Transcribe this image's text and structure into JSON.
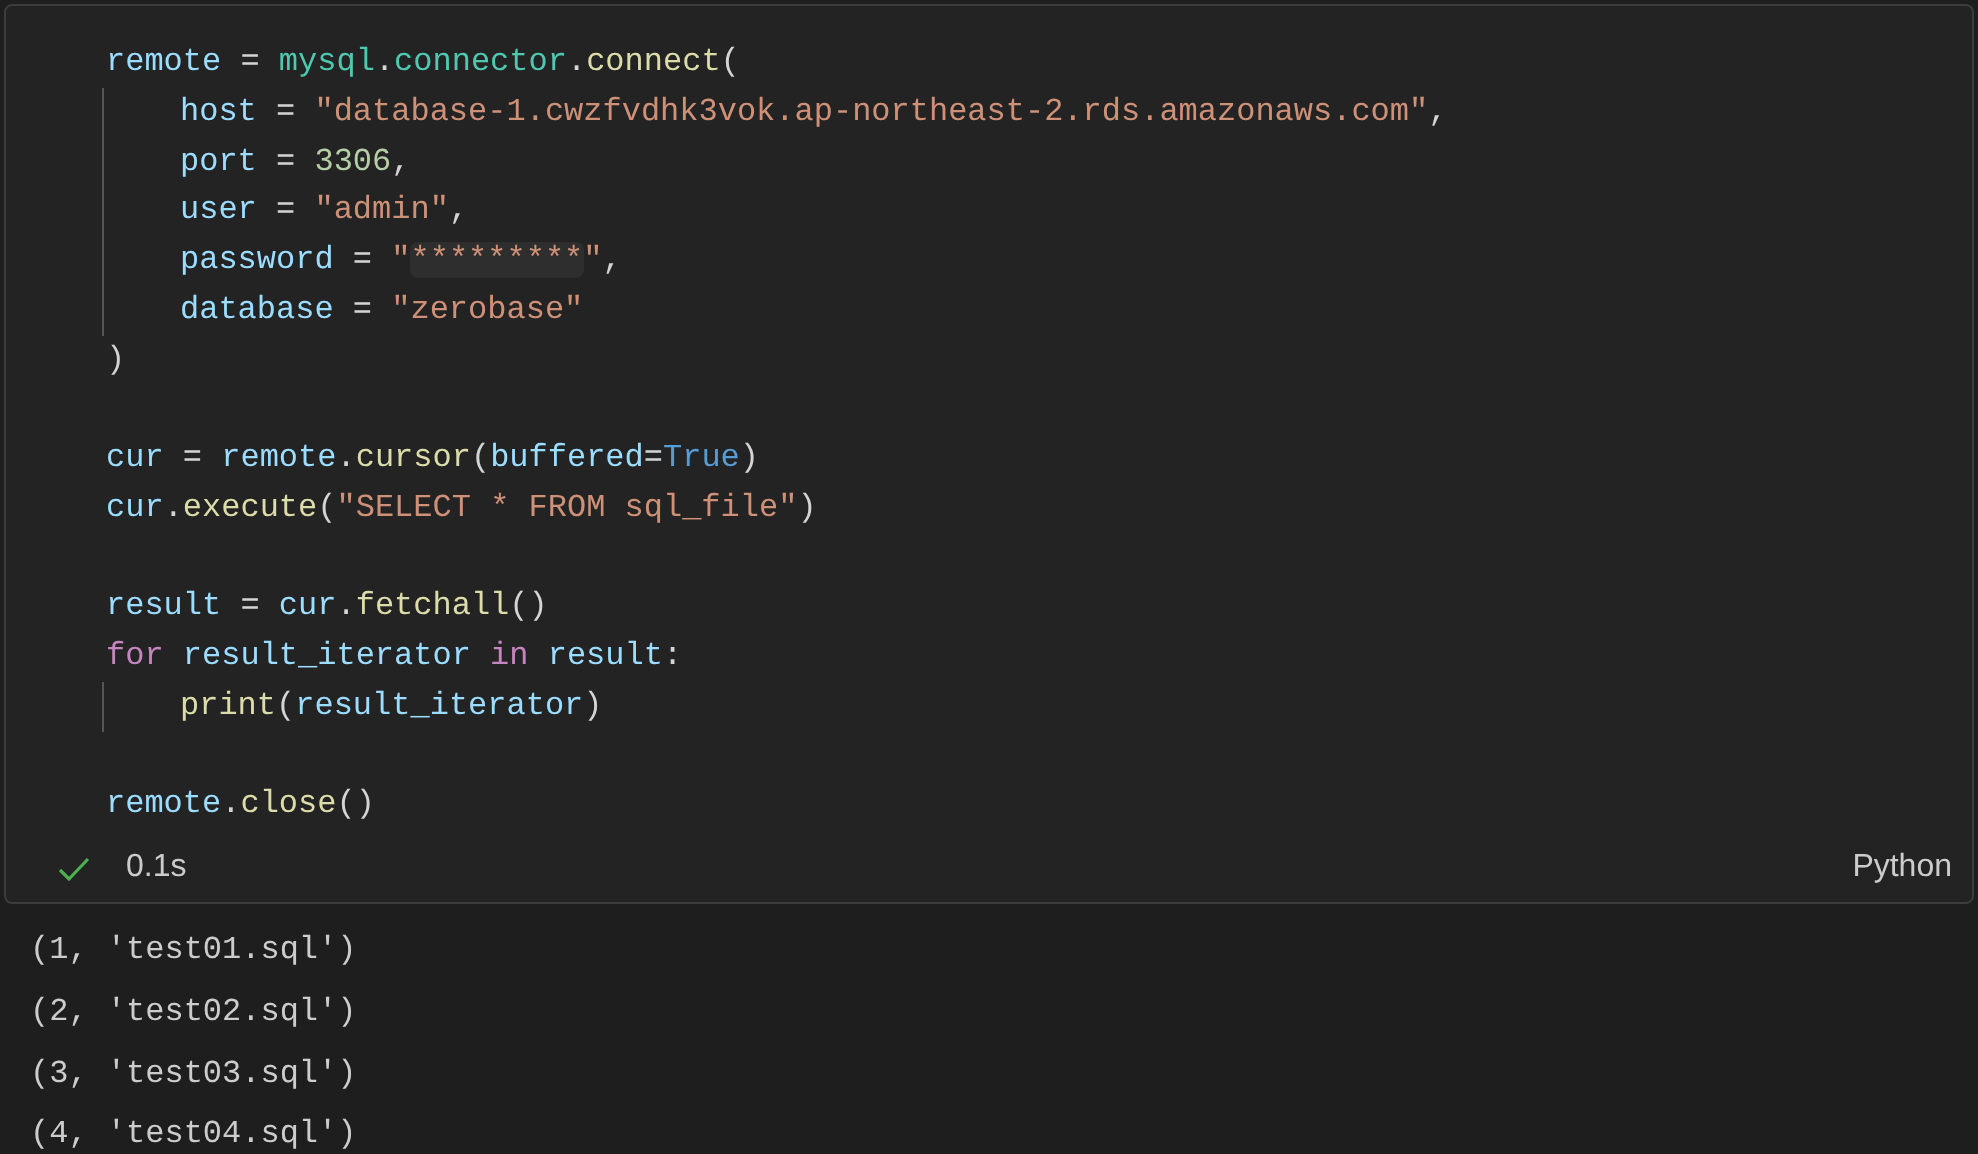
{
  "cell": {
    "lines": [
      {
        "kind": "code",
        "indented": false,
        "tokens": [
          {
            "kind": "var",
            "text": "remote"
          },
          {
            "kind": "punct",
            "text": " = "
          },
          {
            "kind": "module",
            "text": "mysql"
          },
          {
            "kind": "punct",
            "text": "."
          },
          {
            "kind": "module",
            "text": "connector"
          },
          {
            "kind": "punct",
            "text": "."
          },
          {
            "kind": "func",
            "text": "connect"
          },
          {
            "kind": "punct",
            "text": "("
          }
        ]
      },
      {
        "kind": "code",
        "indented": true,
        "tokens": [
          {
            "kind": "var",
            "text": "host"
          },
          {
            "kind": "punct",
            "text": " = "
          },
          {
            "kind": "str",
            "text": "\"database-1.cwzfvdhk3vok.ap-northeast-2.rds.amazonaws.com\""
          },
          {
            "kind": "punct",
            "text": ","
          }
        ]
      },
      {
        "kind": "code",
        "indented": true,
        "tokens": [
          {
            "kind": "var",
            "text": "port"
          },
          {
            "kind": "punct",
            "text": " = "
          },
          {
            "kind": "num",
            "text": "3306"
          },
          {
            "kind": "punct",
            "text": ","
          }
        ]
      },
      {
        "kind": "code",
        "indented": true,
        "tokens": [
          {
            "kind": "var",
            "text": "user"
          },
          {
            "kind": "punct",
            "text": " = "
          },
          {
            "kind": "str",
            "text": "\"admin\""
          },
          {
            "kind": "punct",
            "text": ","
          }
        ]
      },
      {
        "kind": "code",
        "indented": true,
        "tokens": [
          {
            "kind": "var",
            "text": "password"
          },
          {
            "kind": "punct",
            "text": " = "
          },
          {
            "kind": "str",
            "text": "\""
          },
          {
            "kind": "masked",
            "text": "*********"
          },
          {
            "kind": "str",
            "text": "\""
          },
          {
            "kind": "punct",
            "text": ","
          }
        ]
      },
      {
        "kind": "code",
        "indented": true,
        "tokens": [
          {
            "kind": "var",
            "text": "database"
          },
          {
            "kind": "punct",
            "text": " = "
          },
          {
            "kind": "str",
            "text": "\"zerobase\""
          }
        ]
      },
      {
        "kind": "code",
        "indented": false,
        "tokens": [
          {
            "kind": "punct",
            "text": ")"
          }
        ]
      },
      {
        "kind": "blank"
      },
      {
        "kind": "code",
        "indented": false,
        "tokens": [
          {
            "kind": "var",
            "text": "cur"
          },
          {
            "kind": "punct",
            "text": " = "
          },
          {
            "kind": "var",
            "text": "remote"
          },
          {
            "kind": "punct",
            "text": "."
          },
          {
            "kind": "func",
            "text": "cursor"
          },
          {
            "kind": "punct",
            "text": "("
          },
          {
            "kind": "var",
            "text": "buffered"
          },
          {
            "kind": "punct",
            "text": "="
          },
          {
            "kind": "const",
            "text": "True"
          },
          {
            "kind": "punct",
            "text": ")"
          }
        ]
      },
      {
        "kind": "code",
        "indented": false,
        "tokens": [
          {
            "kind": "var",
            "text": "cur"
          },
          {
            "kind": "punct",
            "text": "."
          },
          {
            "kind": "func",
            "text": "execute"
          },
          {
            "kind": "punct",
            "text": "("
          },
          {
            "kind": "str",
            "text": "\"SELECT * FROM sql_file\""
          },
          {
            "kind": "punct",
            "text": ")"
          }
        ]
      },
      {
        "kind": "blank"
      },
      {
        "kind": "code",
        "indented": false,
        "tokens": [
          {
            "kind": "var",
            "text": "result"
          },
          {
            "kind": "punct",
            "text": " = "
          },
          {
            "kind": "var",
            "text": "cur"
          },
          {
            "kind": "punct",
            "text": "."
          },
          {
            "kind": "func",
            "text": "fetchall"
          },
          {
            "kind": "punct",
            "text": "()"
          }
        ]
      },
      {
        "kind": "code",
        "indented": false,
        "tokens": [
          {
            "kind": "kw",
            "text": "for"
          },
          {
            "kind": "var",
            "text": " result_iterator "
          },
          {
            "kind": "kw",
            "text": "in"
          },
          {
            "kind": "var",
            "text": " result"
          },
          {
            "kind": "punct",
            "text": ":"
          }
        ]
      },
      {
        "kind": "code",
        "indented": true,
        "tokens": [
          {
            "kind": "func",
            "text": "print"
          },
          {
            "kind": "punct",
            "text": "("
          },
          {
            "kind": "var",
            "text": "result_iterator"
          },
          {
            "kind": "punct",
            "text": ")"
          }
        ]
      },
      {
        "kind": "blank"
      },
      {
        "kind": "code",
        "indented": false,
        "tokens": [
          {
            "kind": "var",
            "text": "remote"
          },
          {
            "kind": "punct",
            "text": "."
          },
          {
            "kind": "func",
            "text": "close"
          },
          {
            "kind": "punct",
            "text": "()"
          }
        ]
      }
    ],
    "status": {
      "succeeded": true,
      "duration": "0.1s",
      "language": "Python"
    }
  },
  "output": [
    "(1, 'test01.sql')",
    "(2, 'test02.sql')",
    "(3, 'test03.sql')",
    "(4, 'test04.sql')"
  ]
}
